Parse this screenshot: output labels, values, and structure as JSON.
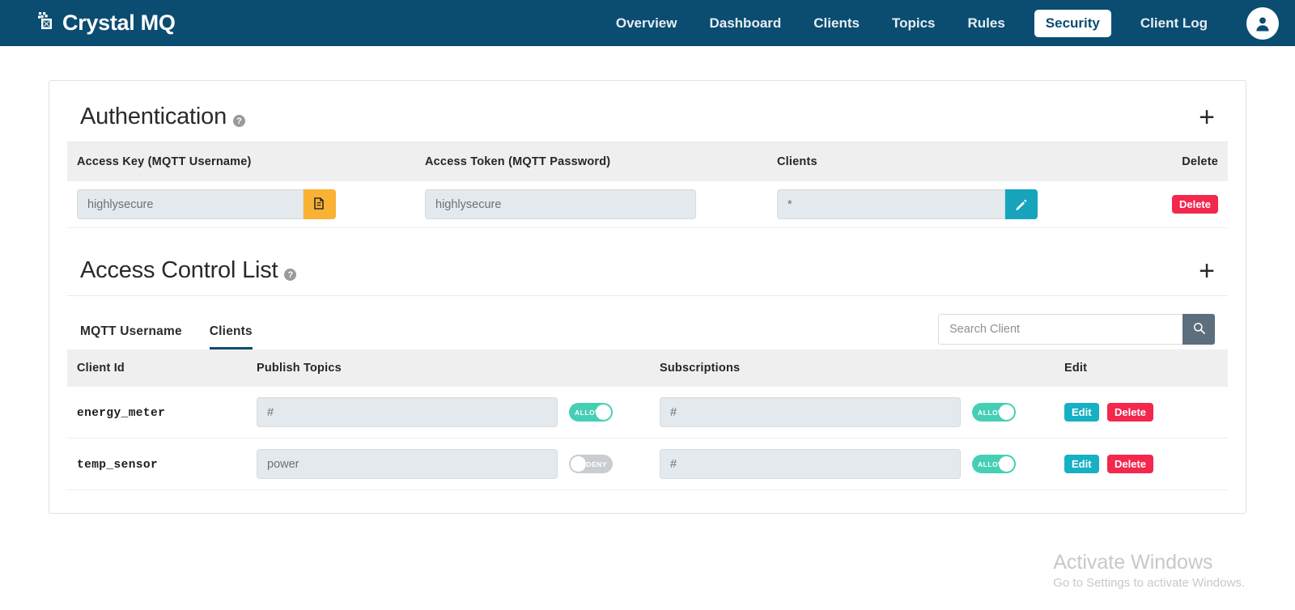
{
  "navbar": {
    "brand": "Crystal MQ",
    "logo_icon": "crystal-mq-logo-icon",
    "links": [
      {
        "label": "Overview",
        "active": false
      },
      {
        "label": "Dashboard",
        "active": false
      },
      {
        "label": "Clients",
        "active": false
      },
      {
        "label": "Topics",
        "active": false
      },
      {
        "label": "Rules",
        "active": false
      },
      {
        "label": "Security",
        "active": true
      },
      {
        "label": "Client Log",
        "active": false
      }
    ],
    "avatar_icon": "user-avatar-icon"
  },
  "authentication": {
    "title": "Authentication",
    "help_icon": "help-circle-icon",
    "add_label": "+",
    "columns": [
      "Access Key (MQTT Username)",
      "Access Token (MQTT Password)",
      "Clients",
      "Delete"
    ],
    "rows": [
      {
        "access_key": "highlysecure",
        "copy_icon": "copy-icon",
        "access_token": "highlysecure",
        "clients": "*",
        "edit_icon": "pencil-icon",
        "delete_label": "Delete"
      }
    ]
  },
  "acl": {
    "title": "Access Control List",
    "help_icon": "help-circle-icon",
    "add_label": "+",
    "tabs": [
      {
        "label": "MQTT Username",
        "active": false
      },
      {
        "label": "Clients",
        "active": true
      }
    ],
    "search": {
      "placeholder": "Search Client",
      "value": "",
      "icon": "search-icon"
    },
    "columns": [
      "Client Id",
      "Publish Topics",
      "Subscriptions",
      "Edit"
    ],
    "rows": [
      {
        "client_id": "energy_meter",
        "publish_topic": "#",
        "publish_state": "ALLOW",
        "subscription": "#",
        "subscription_state": "ALLOW",
        "edit_label": "Edit",
        "delete_label": "Delete"
      },
      {
        "client_id": "temp_sensor",
        "publish_topic": "power",
        "publish_state": "DENY",
        "subscription": "#",
        "subscription_state": "ALLOW",
        "edit_label": "Edit",
        "delete_label": "Delete"
      }
    ]
  },
  "watermark": {
    "title": "Activate Windows",
    "subtitle": "Go to Settings to activate Windows."
  },
  "colors": {
    "nav_bg": "#0b4c71",
    "copy_accent": "#f9b233",
    "edit_accent": "#16a4bd",
    "delete_accent": "#f4274c",
    "toggle_on": "#45cfb4",
    "toggle_off": "#c9cdd2",
    "search_btn": "#5d6e7c"
  }
}
